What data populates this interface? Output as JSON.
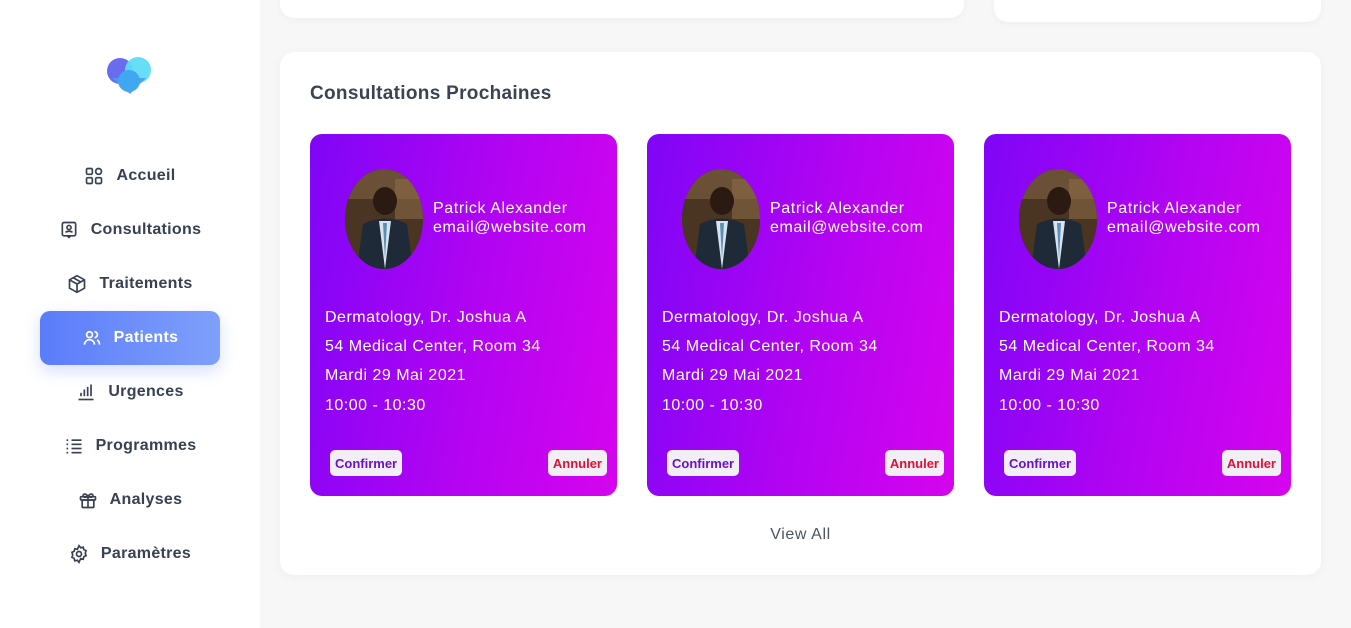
{
  "sidebar": {
    "items": [
      {
        "label": "Accueil",
        "icon": "grid-icon"
      },
      {
        "label": "Consultations",
        "icon": "user-badge-icon"
      },
      {
        "label": "Traitements",
        "icon": "box-icon"
      },
      {
        "label": "Patients",
        "icon": "users-icon",
        "active": true
      },
      {
        "label": "Urgences",
        "icon": "bar-chart-icon"
      },
      {
        "label": "Programmes",
        "icon": "list-icon"
      },
      {
        "label": "Analyses",
        "icon": "gift-icon"
      },
      {
        "label": "Paramètres",
        "icon": "gear-icon"
      }
    ]
  },
  "consultations": {
    "title": "Consultations Prochaines",
    "view_all": "View All",
    "cards": [
      {
        "name": "Patrick Alexander",
        "email": "email@website.com",
        "department": "Dermatology, Dr. Joshua A",
        "location": "54 Medical Center, Room 34",
        "date": "Mardi 29 Mai 2021",
        "time": "10:00 - 10:30",
        "confirm_label": "Confirmer",
        "cancel_label": "Annuler"
      },
      {
        "name": "Patrick Alexander",
        "email": "email@website.com",
        "department": "Dermatology, Dr. Joshua A",
        "location": "54 Medical Center, Room 34",
        "date": "Mardi 29 Mai 2021",
        "time": "10:00 - 10:30",
        "confirm_label": "Confirmer",
        "cancel_label": "Annuler"
      },
      {
        "name": "Patrick Alexander",
        "email": "email@website.com",
        "department": "Dermatology, Dr. Joshua A",
        "location": "54 Medical Center, Room 34",
        "date": "Mardi 29 Mai 2021",
        "time": "10:00 - 10:30",
        "confirm_label": "Confirmer",
        "cancel_label": "Annuler"
      }
    ]
  },
  "colors": {
    "accent": "#5b7cfa",
    "card_gradient_start": "#7f05f7",
    "card_gradient_end": "#d604ee",
    "confirm_text": "#6d0fd1",
    "cancel_text": "#e01036"
  }
}
